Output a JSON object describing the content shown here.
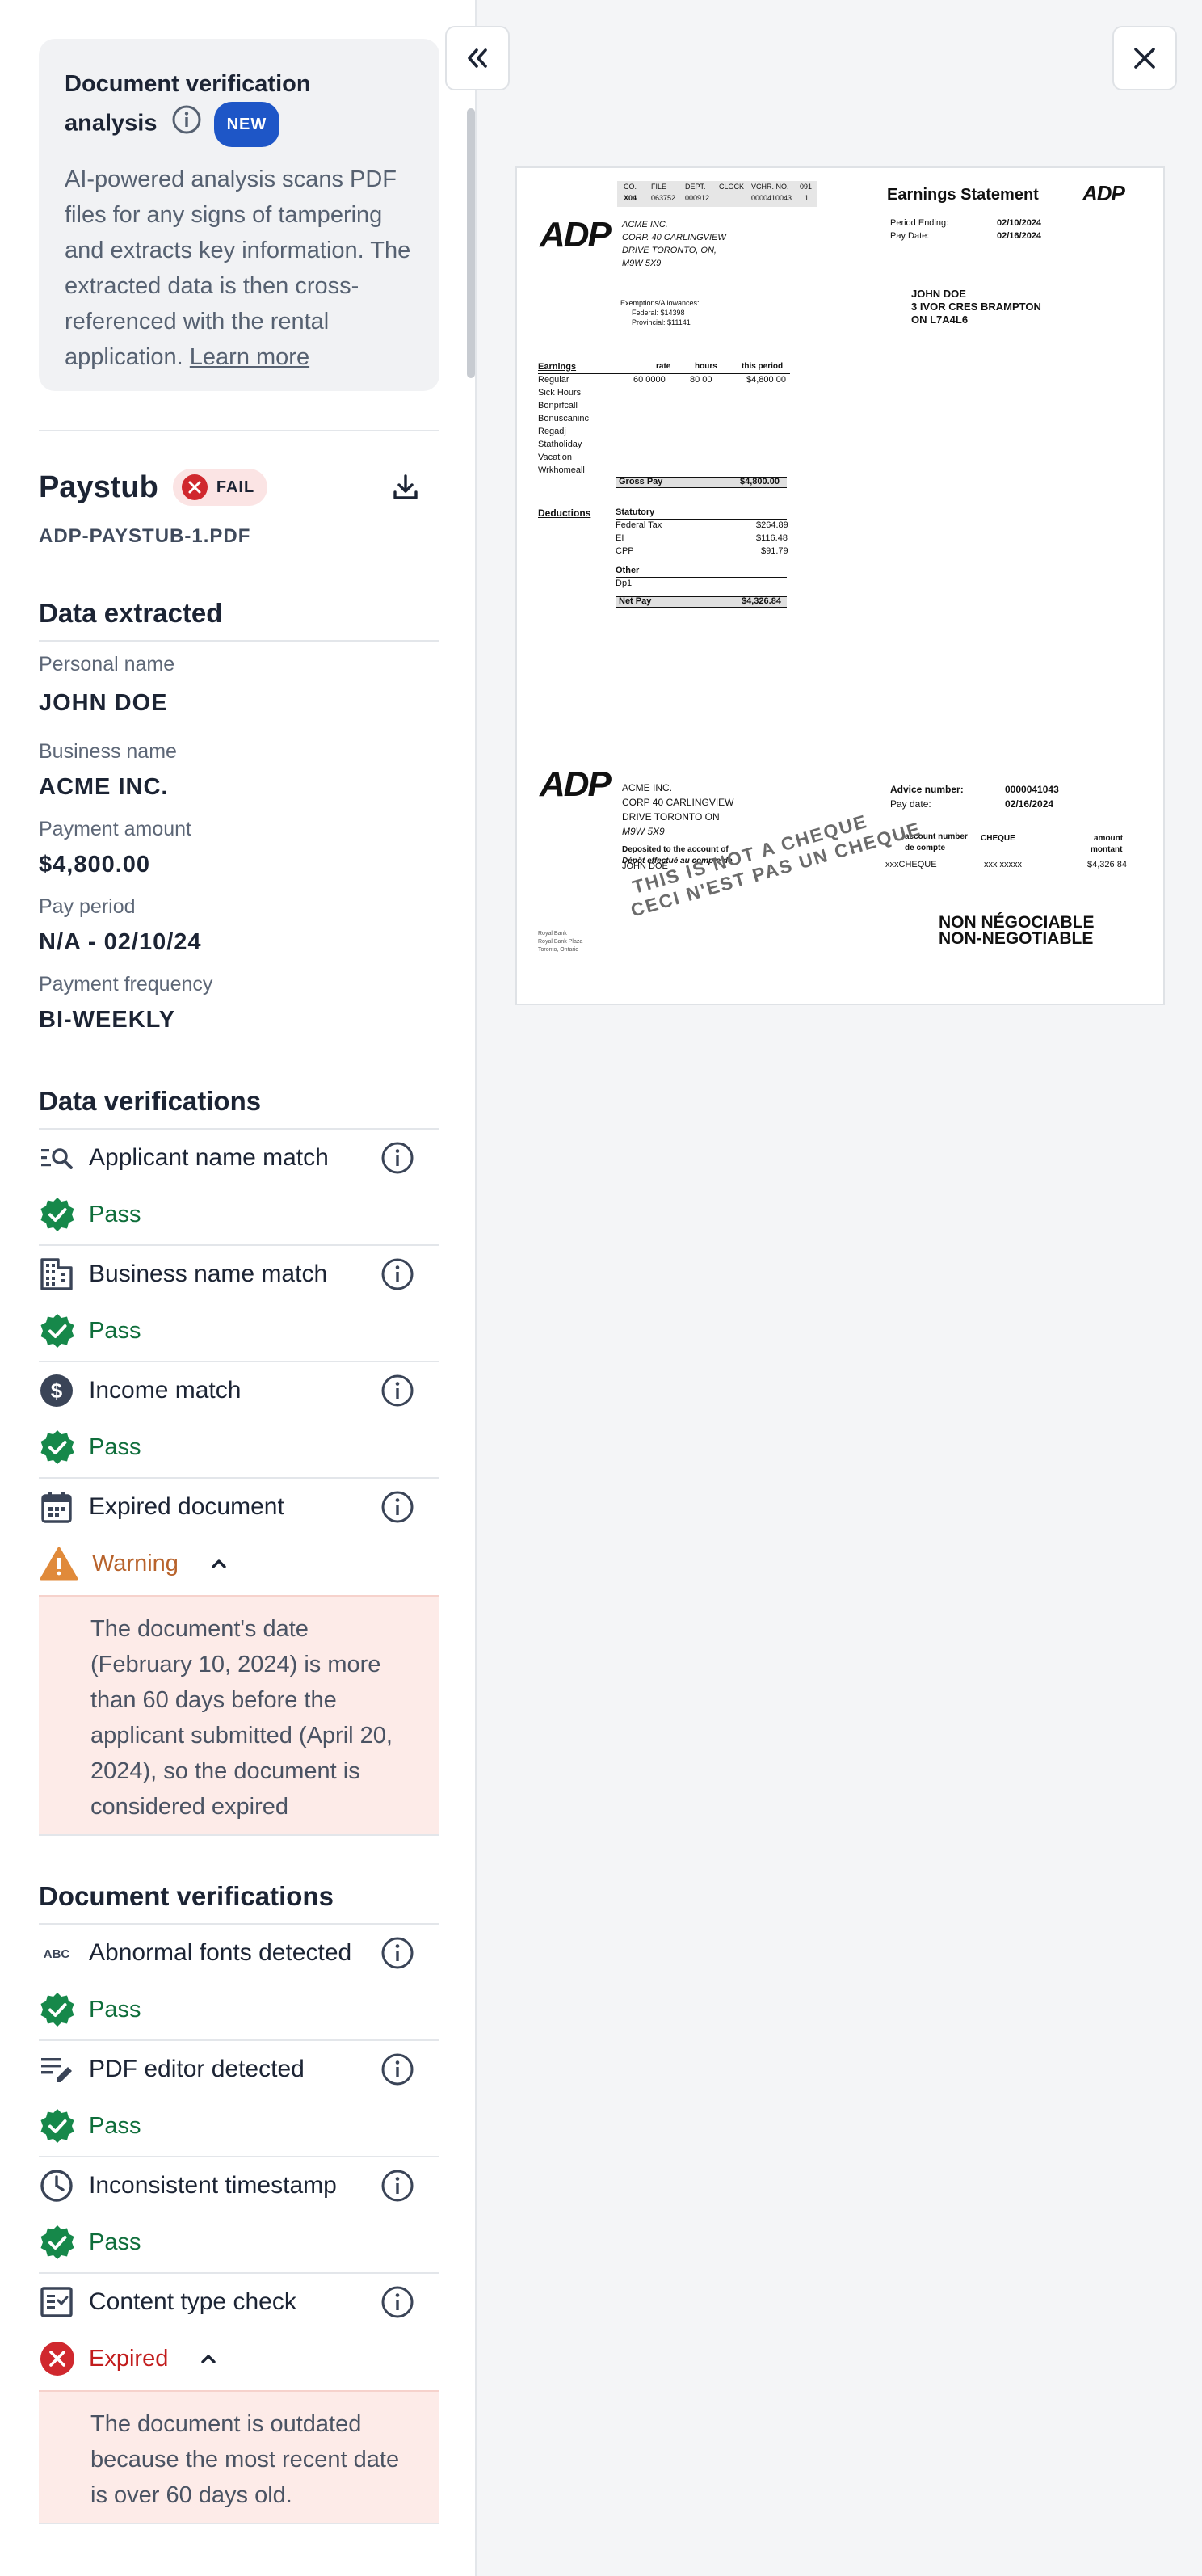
{
  "info_card": {
    "title_line1": "Document verification",
    "title_line2": "analysis",
    "new_badge": "NEW",
    "body": "AI-powered analysis scans PDF files for any signs of tampering and extracts key information. The extracted data is then cross-referenced with the rental application.",
    "learn_more": "Learn more"
  },
  "paystub": {
    "title": "Paystub",
    "badge": "FAIL",
    "filename": "ADP-PAYSTUB-1.PDF"
  },
  "data_extracted": {
    "title": "Data extracted",
    "fields": [
      {
        "label": "Personal name",
        "value": "JOHN DOE"
      },
      {
        "label": "Business name",
        "value": "ACME INC."
      },
      {
        "label": "Payment amount",
        "value": "$4,800.00"
      },
      {
        "label": "Pay period",
        "value": "N/A - 02/10/24"
      },
      {
        "label": "Payment frequency",
        "value": "BI-WEEKLY"
      }
    ]
  },
  "data_verifications": {
    "title": "Data verifications",
    "items": [
      {
        "name": "Applicant name match",
        "status": "Pass",
        "icon": "name-search-icon"
      },
      {
        "name": "Business name match",
        "status": "Pass",
        "icon": "building-icon"
      },
      {
        "name": "Income match",
        "status": "Pass",
        "icon": "dollar-icon"
      },
      {
        "name": "Expired document",
        "status": "Warning",
        "icon": "calendar-icon",
        "note": "The document's date (February 10, 2024) is more than 60 days before the applicant submitted (April 20, 2024), so the document is considered expired"
      }
    ]
  },
  "document_verifications": {
    "title": "Document verifications",
    "items": [
      {
        "name": "Abnormal fonts detected",
        "status": "Pass",
        "icon": "abc-icon"
      },
      {
        "name": "PDF editor detected",
        "status": "Pass",
        "icon": "edit-list-icon"
      },
      {
        "name": "Inconsistent timestamp",
        "status": "Pass",
        "icon": "clock-icon"
      },
      {
        "name": "Content type check",
        "status": "Expired",
        "icon": "checklist-icon",
        "note": "The document is outdated because the most recent date is over 60 days old."
      }
    ]
  },
  "document_preview": {
    "header_cols": [
      "CO.",
      "FILE",
      "DEPT.",
      "CLOCK",
      "VCHR. NO.",
      "091"
    ],
    "header_vals": [
      "X04",
      "063752",
      "000912",
      "",
      "0000410043",
      "1"
    ],
    "title": "Earnings Statement",
    "logo": "ADP",
    "company_lines": [
      "ACME INC.",
      "CORP. 40 CARLINGVIEW",
      "DRIVE TORONTO,  ON,",
      "M9W 5X9"
    ],
    "period_ending_label": "Period Ending:",
    "period_ending": "02/10/2024",
    "pay_date_label": "Pay Date:",
    "pay_date": "02/16/2024",
    "employee_lines": [
      "JOHN DOE",
      "3 IVOR CRES BRAMPTON",
      "ON  L7A4L6"
    ],
    "exemptions": [
      "Exemptions/Allowances:",
      "Federal:      $14398",
      "Provincial:   $11141"
    ],
    "earnings_header": [
      "Earnings",
      "rate",
      "hours",
      "this period"
    ],
    "earnings_rows": [
      "Regular",
      "Sick Hours",
      "Bonprfcall",
      "Bonuscaninc",
      "Regadj",
      "Statholiday",
      "Vacation",
      "Wrkhomeall"
    ],
    "earnings_regular": [
      "60 0000",
      "80 00",
      "$4,800 00"
    ],
    "gross_pay_label": "Gross Pay",
    "gross_pay": "$4,800.00",
    "deductions_label": "Deductions",
    "statutory_label": "Statutory",
    "deduction_rows": [
      {
        "name": "Federal Tax",
        "amount": "$264.89"
      },
      {
        "name": "EI",
        "amount": "$116.48"
      },
      {
        "name": "CPP",
        "amount": "$91.79"
      }
    ],
    "other_label": "Other",
    "other_rows": [
      "Dp1"
    ],
    "net_pay_label": "Net Pay",
    "net_pay": "$4,326.84",
    "advice_company": [
      "ACME INC.",
      "CORP 40 CARLINGVIEW",
      "DRIVE TORONTO    ON",
      "M9W 5X9"
    ],
    "advice_number_label": "Advice number:",
    "advice_number": "0000041043",
    "advice_pay_date_label": "Pay date:",
    "advice_pay_date": "02/16/2024",
    "deposited_label": "Deposited   to  the  account   of",
    "deposited_fr": "Dépôt  effectué au  compte   de",
    "account_number_label": "account number",
    "account_number_fr": "de compte",
    "cheque_label": "CHEQUE",
    "amount_label": "amount",
    "amount_fr": "montant",
    "account_holder": "JOHN DOE",
    "cheque_value": "xxxCHEQUE",
    "account_mask": "xxx  xxxxx",
    "amount_value": "$4,326  84",
    "watermark1": "THIS IS NOT A CHEQUE",
    "watermark2": "CECI N'EST PAS UN CHEQUE",
    "non_negotiable_fr": "NON  NÉGOCIABLE",
    "non_negotiable": "NON-NEGOTIABLE",
    "bank_lines": [
      "Royal Bank",
      "Royal Bank Plaza",
      "Toronto, Ontario"
    ]
  }
}
